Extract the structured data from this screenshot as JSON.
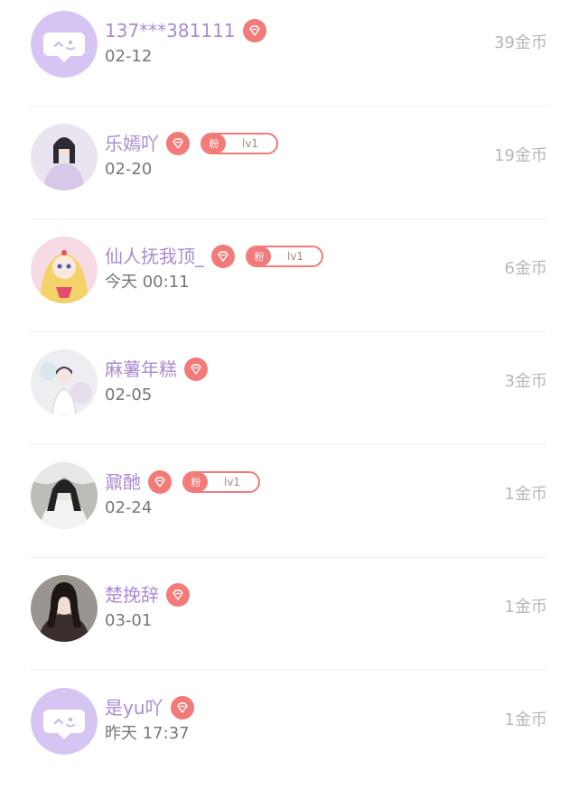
{
  "colors": {
    "accent_purple": "#a98bd0",
    "badge_red": "#f27a78",
    "date_gray": "#777777",
    "coins_gray": "#b8b6ba"
  },
  "rows": [
    {
      "name": "137***381111",
      "date": "02-12",
      "coins": "39金币",
      "avatar": "default-chat-avatar",
      "fan_badge": null
    },
    {
      "name": "乐嫣吖",
      "date": "02-20",
      "coins": "19金币",
      "avatar": "user-photo-avatar",
      "fan_badge": {
        "label": "粉",
        "level": "lv1"
      }
    },
    {
      "name": "仙人抚我顶_",
      "date": "今天 00:11",
      "coins": "6金币",
      "avatar": "user-photo-avatar",
      "fan_badge": {
        "label": "粉",
        "level": "lv1"
      }
    },
    {
      "name": "麻薯年糕",
      "date": "02-05",
      "coins": "3金币",
      "avatar": "user-photo-avatar",
      "fan_badge": null
    },
    {
      "name": "鼐酏",
      "date": "02-24",
      "coins": "1金币",
      "avatar": "user-photo-avatar",
      "fan_badge": {
        "label": "粉",
        "level": "lv1"
      }
    },
    {
      "name": "楚挽辞",
      "date": "03-01",
      "coins": "1金币",
      "avatar": "user-photo-avatar",
      "fan_badge": null
    },
    {
      "name": "是yu吖",
      "date": "昨天 17:37",
      "coins": "1金币",
      "avatar": "default-chat-avatar",
      "fan_badge": null
    }
  ]
}
